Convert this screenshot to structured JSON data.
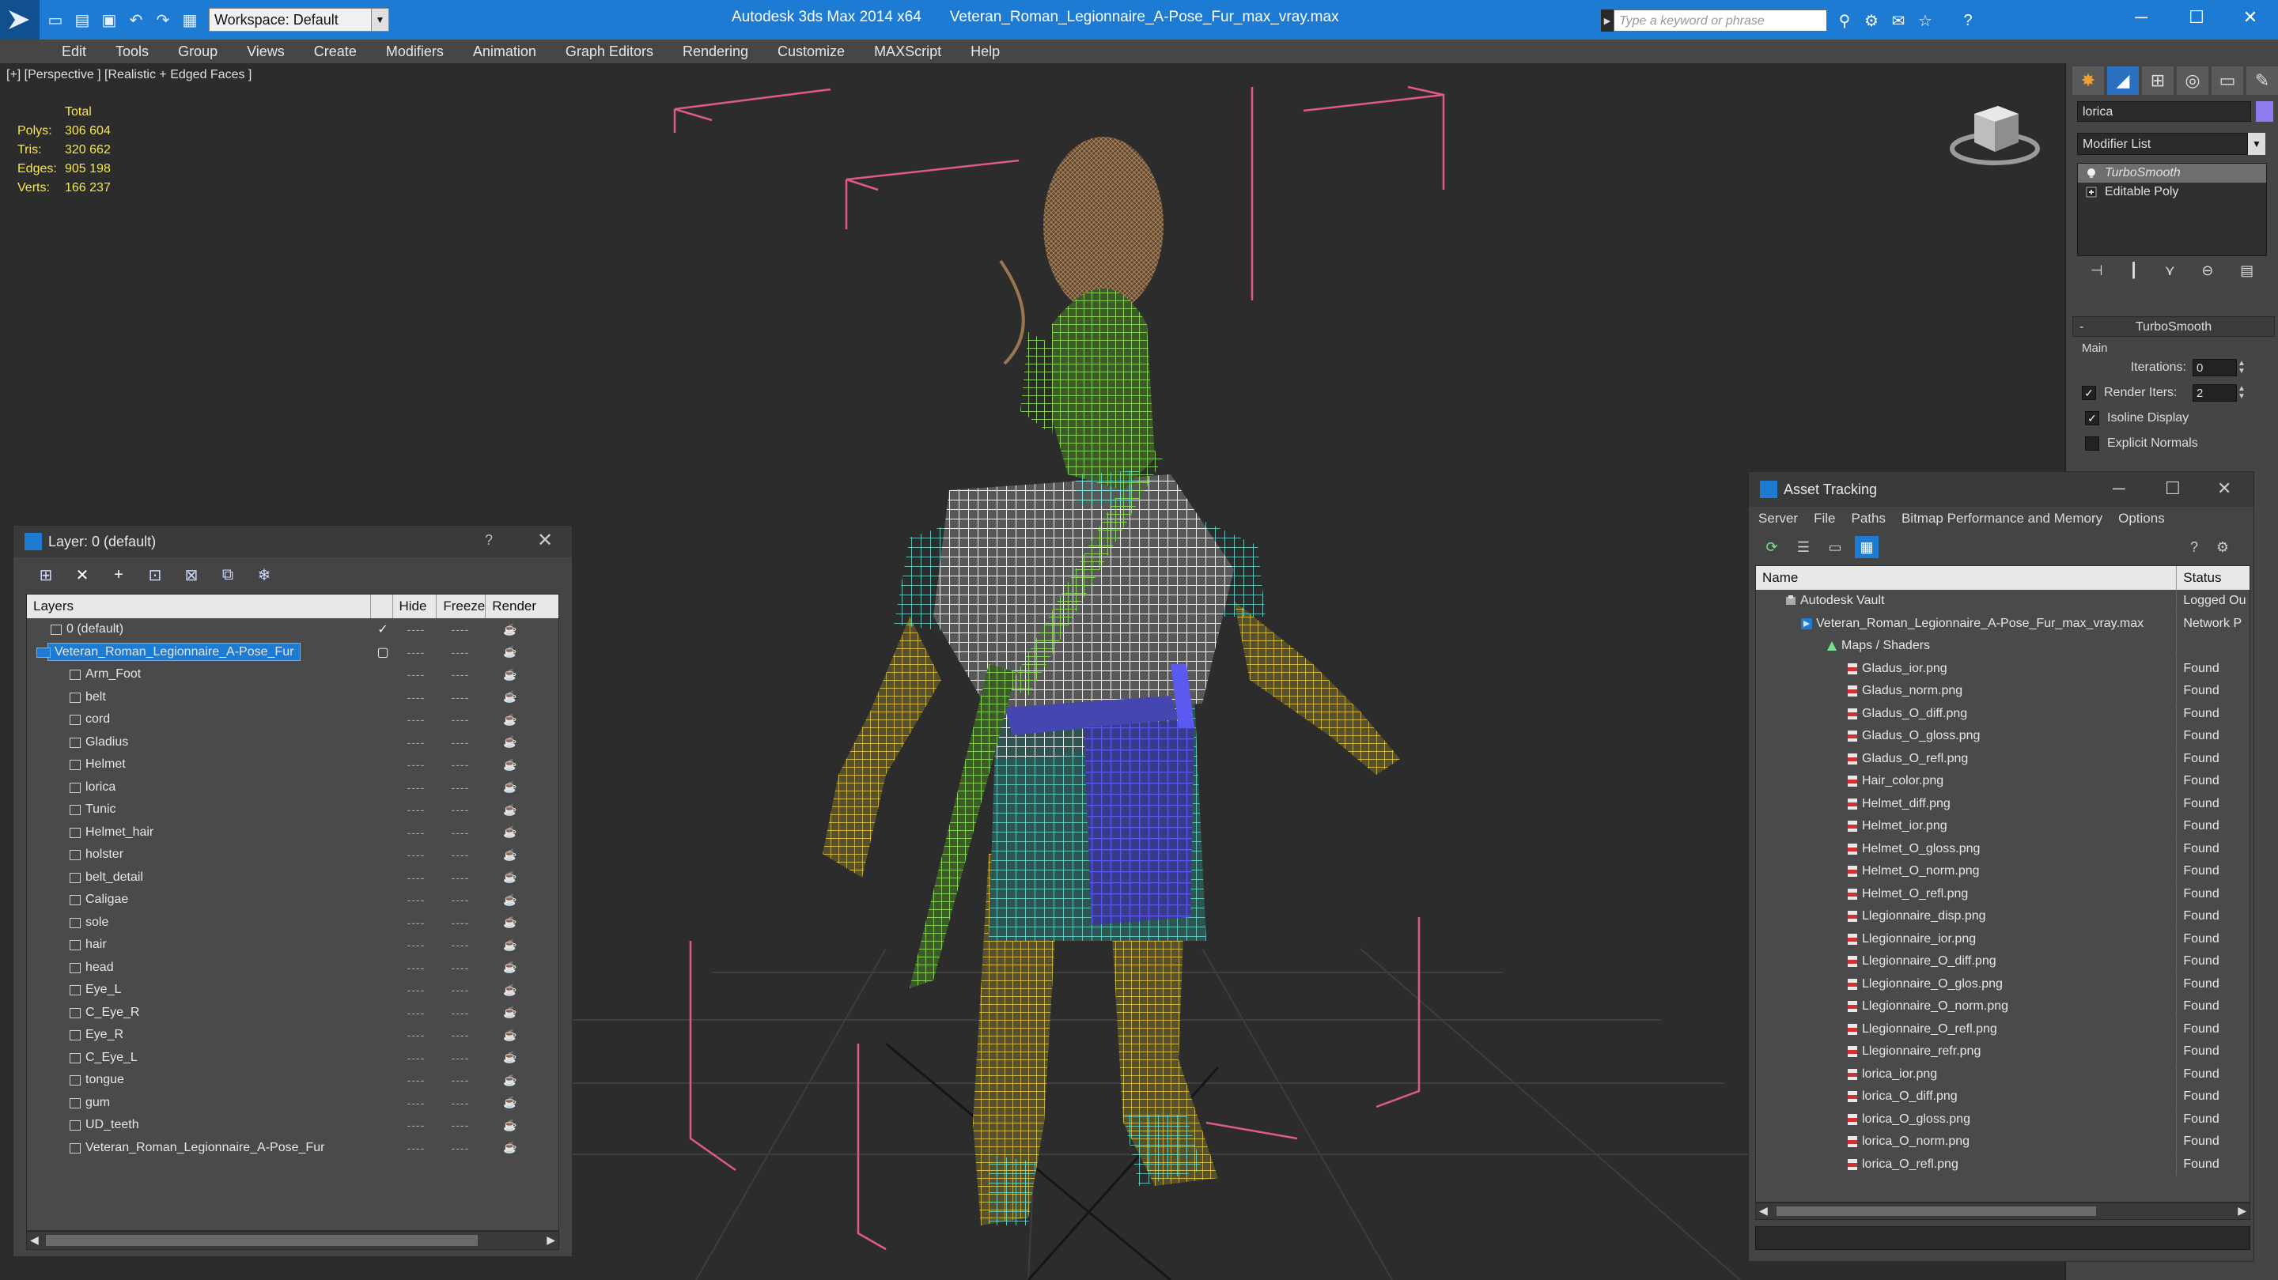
{
  "titlebar": {
    "workspace": "Workspace: Default",
    "app_title": "Autodesk 3ds Max  2014 x64",
    "file_title": "Veteran_Roman_Legionnaire_A-Pose_Fur_max_vray.max",
    "search_placeholder": "Type a keyword or phrase"
  },
  "menu": [
    "Edit",
    "Tools",
    "Group",
    "Views",
    "Create",
    "Modifiers",
    "Animation",
    "Graph Editors",
    "Rendering",
    "Customize",
    "MAXScript",
    "Help"
  ],
  "viewport": {
    "label": "[+] [Perspective ] [Realistic + Edged Faces ]",
    "stats_header": "Total",
    "stats": [
      {
        "k": "Polys:",
        "v": "306 604"
      },
      {
        "k": "Tris:",
        "v": "320 662"
      },
      {
        "k": "Edges:",
        "v": "905 198"
      },
      {
        "k": "Verts:",
        "v": "166 237"
      }
    ]
  },
  "command_panel": {
    "object_name": "lorica",
    "object_color": "#8c7cf0",
    "modifier_list": "Modifier List",
    "stack": [
      "TurboSmooth",
      "Editable Poly"
    ],
    "rollout_title": "TurboSmooth",
    "main_label": "Main",
    "iterations_label": "Iterations:",
    "iterations_value": "0",
    "render_iters_label": "Render Iters:",
    "render_iters_value": "2",
    "isoline_label": "Isoline Display",
    "explicit_label": "Explicit Normals"
  },
  "layer_dialog": {
    "title": "Layer: 0 (default)",
    "help": "?",
    "columns": [
      "Layers",
      "Hide",
      "Freeze",
      "Render"
    ],
    "default_layer": "0 (default)",
    "selected_layer": "Veteran_Roman_Legionnaire_A-Pose_Fur",
    "objects": [
      "Arm_Foot",
      "belt",
      "cord",
      "Gladius",
      "Helmet",
      "lorica",
      "Tunic",
      "Helmet_hair",
      "holster",
      "belt_detail",
      "Caligae",
      "sole",
      "hair",
      "head",
      "Eye_L",
      "C_Eye_R",
      "Eye_R",
      "C_Eye_L",
      "tongue",
      "gum",
      "UD_teeth",
      "Veteran_Roman_Legionnaire_A-Pose_Fur"
    ]
  },
  "asset_dialog": {
    "title": "Asset Tracking",
    "menu": [
      "Server",
      "File",
      "Paths",
      "Bitmap Performance and Memory",
      "Options"
    ],
    "columns": [
      "Name",
      "Status"
    ],
    "vault": {
      "name": "Autodesk Vault",
      "status": "Logged Ou"
    },
    "scene": {
      "name": "Veteran_Roman_Legionnaire_A-Pose_Fur_max_vray.max",
      "status": "Network P"
    },
    "maps_folder": "Maps / Shaders",
    "files": [
      {
        "name": "Gladus_ior.png",
        "status": "Found"
      },
      {
        "name": "Gladus_norm.png",
        "status": "Found"
      },
      {
        "name": "Gladus_O_diff.png",
        "status": "Found"
      },
      {
        "name": "Gladus_O_gloss.png",
        "status": "Found"
      },
      {
        "name": "Gladus_O_refl.png",
        "status": "Found"
      },
      {
        "name": "Hair_color.png",
        "status": "Found"
      },
      {
        "name": "Helmet_diff.png",
        "status": "Found"
      },
      {
        "name": "Helmet_ior.png",
        "status": "Found"
      },
      {
        "name": "Helmet_O_gloss.png",
        "status": "Found"
      },
      {
        "name": "Helmet_O_norm.png",
        "status": "Found"
      },
      {
        "name": "Helmet_O_refl.png",
        "status": "Found"
      },
      {
        "name": "Llegionnaire_disp.png",
        "status": "Found"
      },
      {
        "name": "Llegionnaire_ior.png",
        "status": "Found"
      },
      {
        "name": "Llegionnaire_O_diff.png",
        "status": "Found"
      },
      {
        "name": "Llegionnaire_O_glos.png",
        "status": "Found"
      },
      {
        "name": "Llegionnaire_O_norm.png",
        "status": "Found"
      },
      {
        "name": "Llegionnaire_O_refl.png",
        "status": "Found"
      },
      {
        "name": "Llegionnaire_refr.png",
        "status": "Found"
      },
      {
        "name": "lorica_ior.png",
        "status": "Found"
      },
      {
        "name": "lorica_O_diff.png",
        "status": "Found"
      },
      {
        "name": "lorica_O_gloss.png",
        "status": "Found"
      },
      {
        "name": "lorica_O_norm.png",
        "status": "Found"
      },
      {
        "name": "lorica_O_refl.png",
        "status": "Found"
      }
    ]
  },
  "colors": {
    "titlebar": "#1e7bd4",
    "stats_text": "#f7e64a",
    "wire_white": "#f2f2f2",
    "wire_teal": "#6fe3d8",
    "wire_yellow": "#f0d24a",
    "wire_green": "#8ee05a",
    "wire_blue": "#5a5af0",
    "bbox_pink": "#e05a88"
  }
}
